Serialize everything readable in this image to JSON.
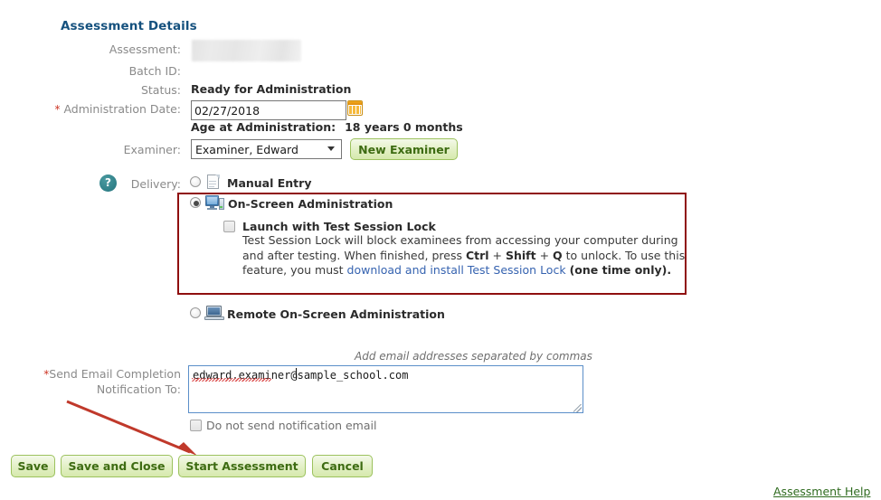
{
  "page": {
    "title": "Assessment Details"
  },
  "fields": {
    "assessment": {
      "label": "Assessment:",
      "value": "",
      "redacted": true
    },
    "batch_id": {
      "label": "Batch ID:",
      "value": ""
    },
    "status": {
      "label": "Status:",
      "value": "Ready for Administration"
    },
    "administration_date": {
      "label": "Administration Date:",
      "required_marker": "*",
      "value": "02/27/2018",
      "calendar_icon": "calendar-icon"
    },
    "age_at_administration": {
      "label": "Age at Administration:",
      "value": "18 years 0 months"
    },
    "examiner": {
      "label": "Examiner:",
      "selected": "Examiner, Edward",
      "options": [
        "Examiner, Edward"
      ],
      "caret_icon": "chevron-down-icon",
      "new_button": "New Examiner"
    },
    "delivery": {
      "label": "Delivery:",
      "help_icon": "question-mark-icon",
      "help_glyph": "?",
      "options": [
        {
          "label": "Manual Entry",
          "icon": "document-icon",
          "selected": false
        },
        {
          "label": "On-Screen Administration",
          "icon": "desktop-computer-icon",
          "selected": true
        },
        {
          "label": "Remote On-Screen Administration",
          "icon": "laptop-icon",
          "selected": false
        }
      ]
    },
    "test_session_lock": {
      "checkbox_label": "Launch with Test Session Lock",
      "checked": false,
      "description_part1": "Test Session Lock will block examinees from accessing your computer during and after testing. When finished, press ",
      "key1": "Ctrl",
      "key_sep1": " + ",
      "key2": "Shift",
      "key_sep2": " + ",
      "key3": "Q",
      "description_part2": " to unlock. To use this feature, you must ",
      "link_text": "download and install Test Session Lock",
      "description_part3": " ",
      "one_time_note": "(one time only).",
      "highlight_border_color": "#8f0f0f",
      "link_color": "#3663b0"
    },
    "email_notification": {
      "required_marker": "*",
      "label_line1": "Send Email Completion",
      "label_line2": "Notification To:",
      "hint": "Add email addresses separated by commas",
      "value": "edward.examiner@sample_school.com",
      "placeholder": "",
      "do_not_send_label": "Do not send notification email",
      "do_not_send_checked": false
    }
  },
  "buttons": {
    "save": "Save",
    "save_and_close": "Save and Close",
    "start_assessment": "Start Assessment",
    "cancel": "Cancel"
  },
  "links": {
    "assessment_help": "Assessment Help"
  },
  "annotation": {
    "arrow_color": "#c0392b",
    "points_to": "Start Assessment"
  },
  "colors": {
    "heading": "#15517e",
    "label": "#8a8a8a",
    "button_text": "#3d6b12",
    "button_border": "#9cc25e",
    "highlight": "#8f0f0f",
    "link": "#3663b0",
    "help_link": "#2f6b1f",
    "required": "#cc3322",
    "textarea_border": "#5b8fc9",
    "help_icon": "#2f8088"
  }
}
